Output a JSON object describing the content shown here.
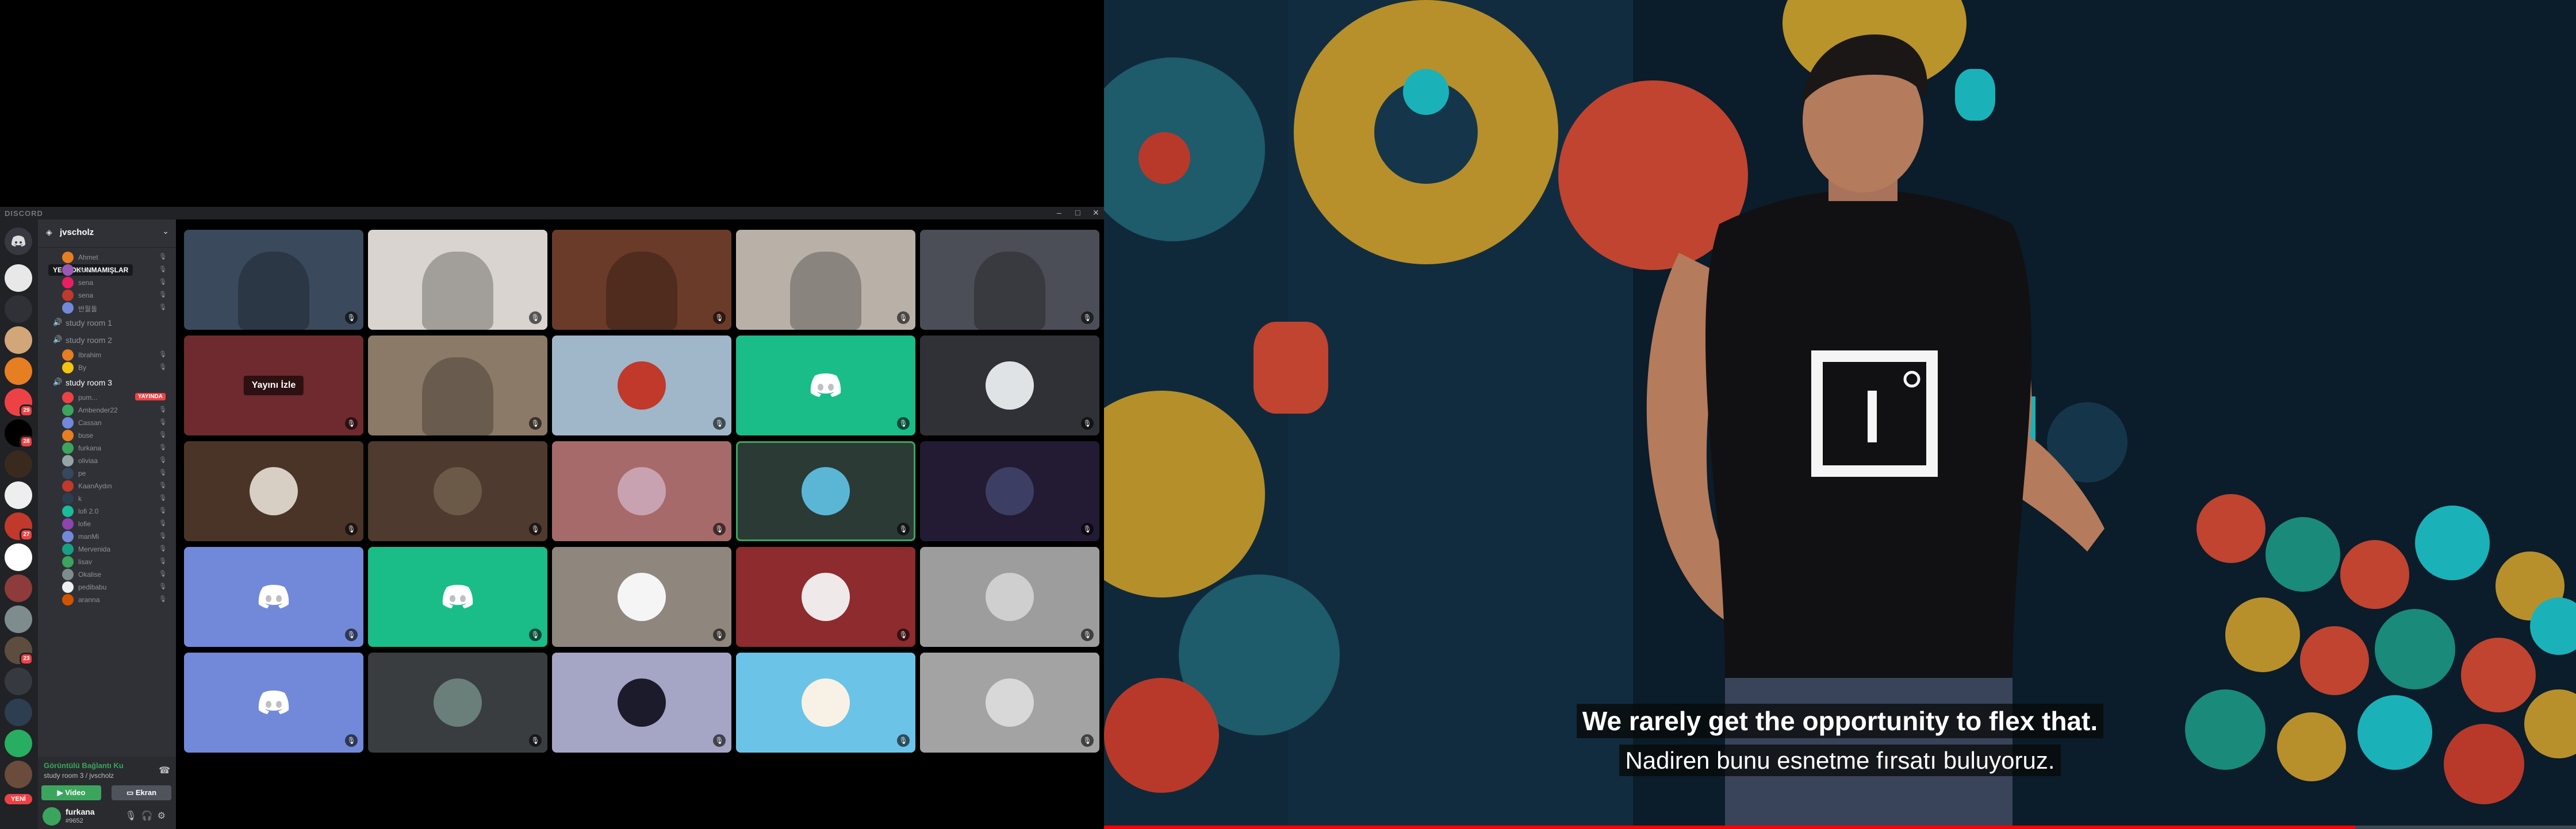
{
  "discord": {
    "app_title": "DISCORD",
    "guild_name": "jvscholz",
    "tooltip": "YENİ OKUNMAMIŞLAR",
    "rail_badges": [
      "29",
      "28",
      "27",
      "23"
    ],
    "rail_new_label": "YENİ",
    "top_users": [
      {
        "name": "Ahmet",
        "color": "#e67e22"
      },
      {
        "name": "zeo",
        "color": "#9b59b6"
      },
      {
        "name": "sena",
        "color": "#e91e63"
      },
      {
        "name": "sena",
        "color": "#c0392b"
      },
      {
        "name": "반월돌",
        "color": "#7289da"
      }
    ],
    "voice_channels": [
      {
        "name": "study room 1",
        "users": []
      },
      {
        "name": "study room 2",
        "users": [
          {
            "name": "Ibrahim",
            "color": "#e67e22"
          },
          {
            "name": "By",
            "color": "#f1c40f"
          }
        ]
      },
      {
        "name": "study room 3",
        "users": [
          {
            "name": "pum...",
            "color": "#ed4245",
            "live": "YAYINDA"
          },
          {
            "name": "Ambender22",
            "color": "#3ba55d"
          },
          {
            "name": "Cassan",
            "color": "#7289da"
          },
          {
            "name": "buse",
            "color": "#e67e22"
          },
          {
            "name": "furkana",
            "color": "#3ba55d"
          },
          {
            "name": "oliviaa",
            "color": "#95a5a6"
          },
          {
            "name": "pe",
            "color": "#34495e"
          },
          {
            "name": "KaanAydın",
            "color": "#c0392b"
          },
          {
            "name": "k",
            "color": "#2c3e50"
          },
          {
            "name": "lofi 2.0",
            "color": "#1abc9c"
          },
          {
            "name": "lofie",
            "color": "#8e44ad"
          },
          {
            "name": "manMi",
            "color": "#7289da"
          },
          {
            "name": "Mervenida",
            "color": "#16a085"
          },
          {
            "name": "lisav",
            "color": "#3ba55d"
          },
          {
            "name": "Okalise",
            "color": "#7f8c8d"
          },
          {
            "name": "pedibabu",
            "color": "#ecf0f1"
          },
          {
            "name": "aranna",
            "color": "#d35400"
          }
        ]
      }
    ],
    "voice_status": "Görüntülü Bağlantı Ku",
    "voice_room": "study room 3 / jvscholz",
    "video_btn": "Video",
    "screen_btn": "Ekran",
    "username": "furkana",
    "user_tag": "#9652",
    "stream_overlay_btn": "Yayını İzle"
  },
  "tiles": [
    {
      "kind": "camera",
      "bg": "#3a4a5c",
      "desc": "child-webcam"
    },
    {
      "kind": "camera",
      "bg": "#d9d4cf",
      "desc": "room-webcam"
    },
    {
      "kind": "camera",
      "bg": "#6b3b2a",
      "desc": "headphone-webcam"
    },
    {
      "kind": "camera",
      "bg": "#b9b0a8",
      "desc": "bookshelf-webcam"
    },
    {
      "kind": "camera",
      "bg": "#4b4e56",
      "desc": "desk-webcam"
    },
    {
      "kind": "stream",
      "bg": "#6e2a2f"
    },
    {
      "kind": "camera",
      "bg": "#8c7a68",
      "desc": "studying-webcam"
    },
    {
      "kind": "avatar",
      "bg": "#9fb7c9",
      "av": "#c0392b"
    },
    {
      "kind": "discord",
      "bg": "#1abc88"
    },
    {
      "kind": "avatar",
      "bg": "#2f3136",
      "av": "#dfe3e6"
    },
    {
      "kind": "avatar",
      "bg": "#4a3428",
      "av": "#d7cfc4"
    },
    {
      "kind": "avatar",
      "bg": "#4e3a2e",
      "av": "#6b5a48"
    },
    {
      "kind": "avatar",
      "bg": "#a76a6a",
      "av": "#c8a2b0"
    },
    {
      "kind": "avatar",
      "bg": "#2b3a35",
      "av": "#5bb6d6",
      "speaking": true
    },
    {
      "kind": "avatar",
      "bg": "#221b33",
      "av": "#3c3f63"
    },
    {
      "kind": "discord",
      "bg": "#7289da"
    },
    {
      "kind": "discord",
      "bg": "#1abc88"
    },
    {
      "kind": "avatar",
      "bg": "#8f877e",
      "av": "#f5f5f5"
    },
    {
      "kind": "avatar",
      "bg": "#8d2b2e",
      "av": "#f0e9e9"
    },
    {
      "kind": "avatar",
      "bg": "#9d9d9d",
      "av": "#cfcfcf"
    },
    {
      "kind": "discord",
      "bg": "#7289da"
    },
    {
      "kind": "avatar",
      "bg": "#3a3d3f",
      "av": "#6a7f7a"
    },
    {
      "kind": "avatar",
      "bg": "#a5a5c5",
      "av": "#1b1b2b"
    },
    {
      "kind": "avatar",
      "bg": "#6cc3e8",
      "av": "#f7f2e5"
    },
    {
      "kind": "avatar",
      "bg": "#a3a3a3",
      "av": "#d8d8d8"
    }
  ],
  "ted": {
    "subtitle_en": "We rarely get the opportunity to flex that.",
    "subtitle_tr": "Nadiren bunu esnetme fırsatı buluyoruz.",
    "progress": 0.85
  }
}
